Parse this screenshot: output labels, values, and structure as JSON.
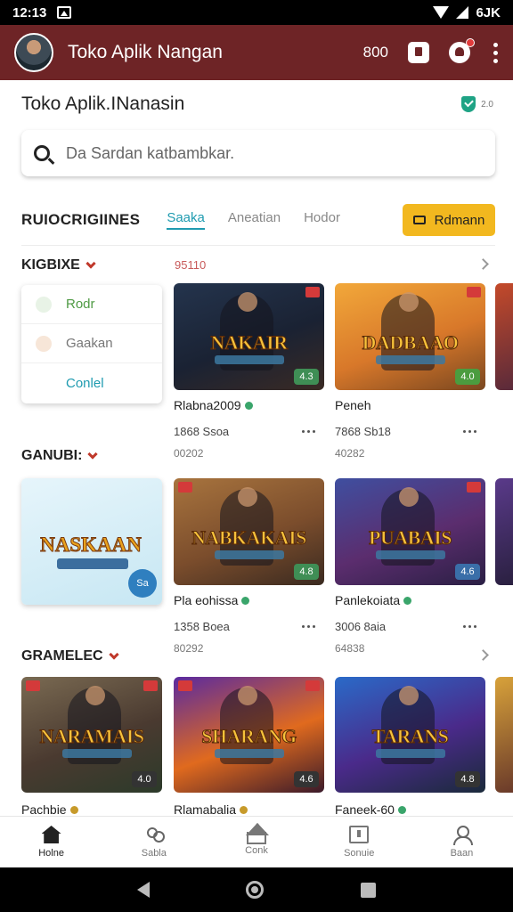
{
  "status_bar": {
    "time": "12:13",
    "battery": "6JK"
  },
  "app_bar": {
    "title": "Toko Aplik Nangan",
    "count": "800",
    "colors": {
      "bar": "#6e2426"
    }
  },
  "page": {
    "title": "Toko Aplik.INanasin",
    "version": "2.0"
  },
  "search": {
    "placeholder": "Da Sardan katbambkar."
  },
  "filter": {
    "label": "RUIOCRIGIINES",
    "tabs": [
      {
        "label": "Saaka",
        "active": true
      },
      {
        "label": "Aneatian",
        "active": false
      },
      {
        "label": "Hodor",
        "active": false
      }
    ],
    "button_label": "Rdmann"
  },
  "section1": {
    "title": "KIGBIXE",
    "count": "95110"
  },
  "dropdown": {
    "items": [
      "Rodr",
      "Gaakan",
      "Conlel"
    ]
  },
  "section2": {
    "title": "GANUBI:"
  },
  "section3": {
    "title": "GRAMELEC"
  },
  "promo": {
    "title": "NASKAAN",
    "badge": "Sa"
  },
  "games": [
    {
      "title": "NAKAIR",
      "name": "Rlabna2009",
      "meta": "1868 Ssoa",
      "size": "00202",
      "rating": "4.3",
      "dot": "#3aa56b",
      "rating_color": "#3f8e55",
      "bg": "linear-gradient(160deg,#24344d,#1a2233 55%,#3a2a24)"
    },
    {
      "title": "DADBAAO",
      "name": "Peneh",
      "meta": "7868 Sb18",
      "size": "40282",
      "rating": "4.0",
      "dot": "#3aa56b",
      "rating_color": "#4b9c3f",
      "bg": "linear-gradient(160deg,#f2a83a,#d8782a 55%,#7a4720)"
    },
    {
      "title": "NABKAKAIS",
      "name": "Pla eohissa",
      "meta": "1358 Boea",
      "size": "80292",
      "rating": "4.8",
      "dot": "#3aa56b",
      "rating_color": "#3f8e55",
      "bg": "linear-gradient(160deg,#a8743e,#7b4d2c 55%,#3a2a20)"
    },
    {
      "title": "PUABAIS",
      "name": "Panlekoiata",
      "meta": "3006 8aia",
      "size": "64838",
      "rating": "4.6",
      "dot": "#3aa56b",
      "rating_color": "#3a6ea8",
      "bg": "linear-gradient(160deg,#3f4fa0,#5b2d6e 55%,#2a1f44)"
    },
    {
      "title": "NARAMAIS",
      "name": "Pachbie",
      "meta": "",
      "size": "",
      "rating": "4.0",
      "dot": "#c79a2a",
      "rating_color": "#333333",
      "bg": "linear-gradient(160deg,#7a6a52,#4a3a30 55%,#2c3a2a)"
    },
    {
      "title": "SHARANG",
      "name": "Rlamabalia",
      "meta": "",
      "size": "",
      "rating": "4.6",
      "dot": "#c79a2a",
      "rating_color": "#333333",
      "bg": "linear-gradient(160deg,#5a2aa0,#e06a1e 55%,#3a1a2a)"
    },
    {
      "title": "TARANS",
      "name": "Faneek-60",
      "meta": "",
      "size": "",
      "rating": "4.8",
      "dot": "#3aa56b",
      "rating_color": "#333333",
      "bg": "linear-gradient(160deg,#2a6ac8,#4a2a8a 55%,#1a2a3a)"
    }
  ],
  "bottom_nav": [
    {
      "label": "Holne",
      "active": true
    },
    {
      "label": "Sabla",
      "active": false
    },
    {
      "label": "Conk",
      "active": false
    },
    {
      "label": "Sonuie",
      "active": false
    },
    {
      "label": "Baan",
      "active": false
    }
  ]
}
